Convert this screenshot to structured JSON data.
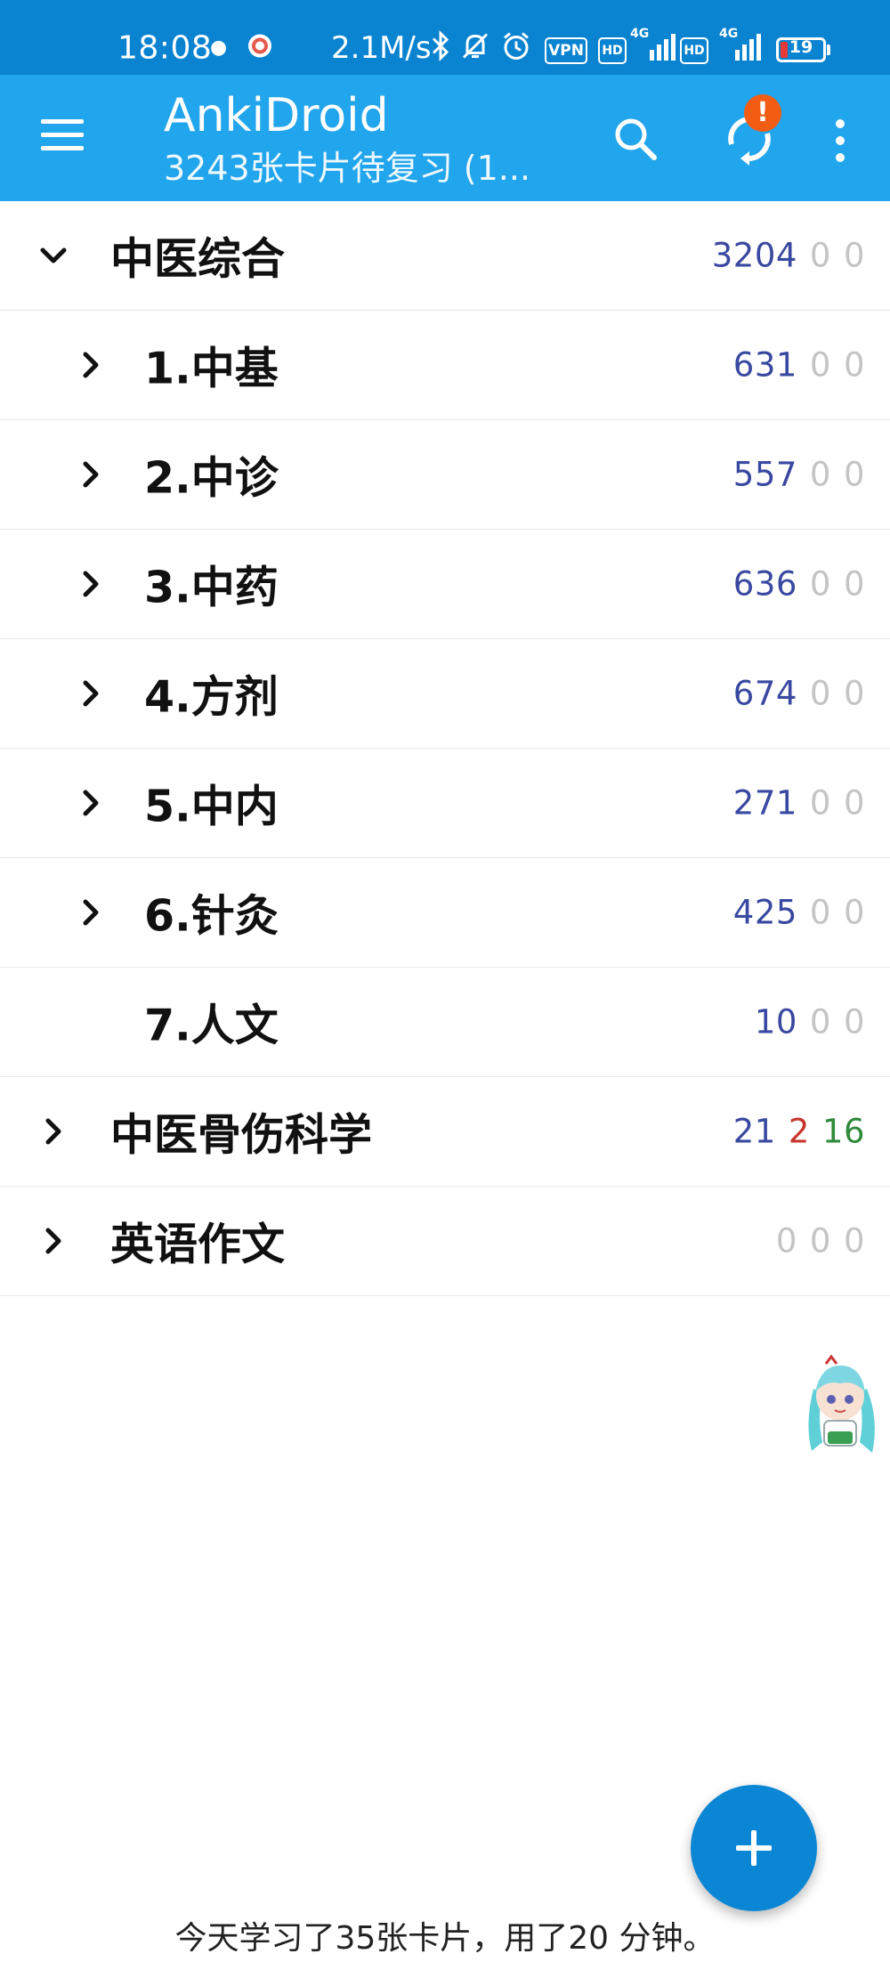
{
  "status_bar": {
    "time": "18:08",
    "network_speed": "2.1M/s",
    "vpn_label": "VPN",
    "hd_label": "HD",
    "signal_label": "4G",
    "battery_level": "19"
  },
  "app_bar": {
    "title": "AnkiDroid",
    "subtitle": "3243张卡片待复习 (1...",
    "sync_badge": "!"
  },
  "decks": [
    {
      "name": "中医综合",
      "expanded": true,
      "level": 0,
      "new": "3204",
      "learn": "0",
      "review": "0"
    },
    {
      "name": "1.中基",
      "expanded": false,
      "level": 1,
      "new": "631",
      "learn": "0",
      "review": "0"
    },
    {
      "name": "2.中诊",
      "expanded": false,
      "level": 1,
      "new": "557",
      "learn": "0",
      "review": "0"
    },
    {
      "name": "3.中药",
      "expanded": false,
      "level": 1,
      "new": "636",
      "learn": "0",
      "review": "0"
    },
    {
      "name": "4.方剂",
      "expanded": false,
      "level": 1,
      "new": "674",
      "learn": "0",
      "review": "0"
    },
    {
      "name": "5.中内",
      "expanded": false,
      "level": 1,
      "new": "271",
      "learn": "0",
      "review": "0"
    },
    {
      "name": "6.针灸",
      "expanded": false,
      "level": 1,
      "new": "425",
      "learn": "0",
      "review": "0"
    },
    {
      "name": "7.人文",
      "expanded": null,
      "level": 1,
      "new": "10",
      "learn": "0",
      "review": "0"
    },
    {
      "name": "中医骨伤科学",
      "expanded": false,
      "level": 0,
      "new": "21",
      "learn": "2",
      "review": "16"
    },
    {
      "name": "英语作文",
      "expanded": false,
      "level": 0,
      "new": "0",
      "learn": "0",
      "review": "0"
    }
  ],
  "footer": {
    "summary": "今天学习了35张卡片，用了20 分钟。"
  },
  "colors": {
    "status_bar": "#0a83d1",
    "app_bar": "#21a5ec",
    "fab": "#0b86d4",
    "new_count": "#3948a0",
    "learn_count": "#c7352c",
    "review_count": "#2f8a3a",
    "zero_count": "#c4c4c4"
  },
  "icons": {
    "menu": "hamburger-menu-icon",
    "search": "search-icon",
    "sync": "sync-icon",
    "more": "more-vert-icon",
    "add": "plus-icon"
  }
}
